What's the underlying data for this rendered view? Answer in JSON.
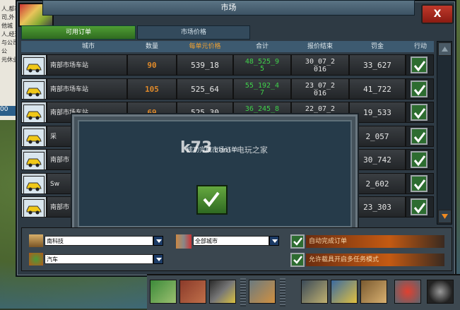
{
  "window": {
    "title": "市场",
    "close_label": "X"
  },
  "tabs": [
    {
      "label": "可用订单"
    },
    {
      "label": "市场价格"
    }
  ],
  "columns": [
    "城市",
    "数量",
    "每单元价格",
    "合计",
    "报价结束",
    "罚金",
    "行动"
  ],
  "rows": [
    {
      "city": "南部市场车站",
      "qty": "90",
      "unit_price": "539_18",
      "total": "48_525_95",
      "total_l1": "48_525_9",
      "total_l2": "5",
      "end_l1": "30_07_2",
      "end_l2": "016",
      "penalty": "33_627"
    },
    {
      "city": "南部市场车站",
      "qty": "105",
      "unit_price": "525_64",
      "total": "55_192_47",
      "total_l1": "55_192_4",
      "total_l2": "7",
      "end_l1": "23_07_2",
      "end_l2": "016",
      "penalty": "41_722"
    },
    {
      "city": "南部市场车站",
      "qty": "69",
      "unit_price": "525_30",
      "total": "36_245_8",
      "total_l1": "36_245_8",
      "total_l2": "",
      "end_l1": "22_07_2",
      "end_l2": "",
      "penalty": "19_533"
    },
    {
      "city": "采",
      "qty": "",
      "unit_price": "",
      "total": "",
      "total_l1": "",
      "total_l2": "",
      "end_l1": "",
      "end_l2": "",
      "penalty": "2_057"
    },
    {
      "city": "南部市",
      "qty": "",
      "unit_price": "",
      "total": "",
      "total_l1": "",
      "total_l2": "",
      "end_l1": "",
      "end_l2": "",
      "penalty": "30_742"
    },
    {
      "city": "Sw",
      "qty": "",
      "unit_price": "",
      "total": "",
      "total_l1": "",
      "total_l2": "",
      "end_l1": "",
      "end_l2": "",
      "penalty": "2_602"
    },
    {
      "city": "南部市",
      "qty": "",
      "unit_price": "",
      "total": "",
      "total_l1": "",
      "total_l2": "",
      "end_l1": "",
      "end_l2": "",
      "penalty": "23_303"
    }
  ],
  "modal": {
    "message": "成功完成市场订单"
  },
  "watermark": {
    "main": "k73",
    "site": "电玩之家",
    "domain": ".com"
  },
  "filters": {
    "company_value": "南科技",
    "city_value": "全部城市",
    "vehicle_value": "汽车"
  },
  "options": [
    {
      "label": "自动完成订单",
      "checked": true
    },
    {
      "label": "允许载具开启多任务模式",
      "checked": true
    }
  ],
  "left_panel": {
    "lines": [
      "人,都市",
      "司,外",
      "他城",
      "人,经过",
      "与公司",
      "公",
      "元休业"
    ],
    "stripe": "00"
  },
  "colors": {
    "quantity": "#e08a2a",
    "total": "#3fd14a",
    "price_header": "#f0a030",
    "active_tab": "#4f9e34",
    "close_button": "#c0392b"
  }
}
